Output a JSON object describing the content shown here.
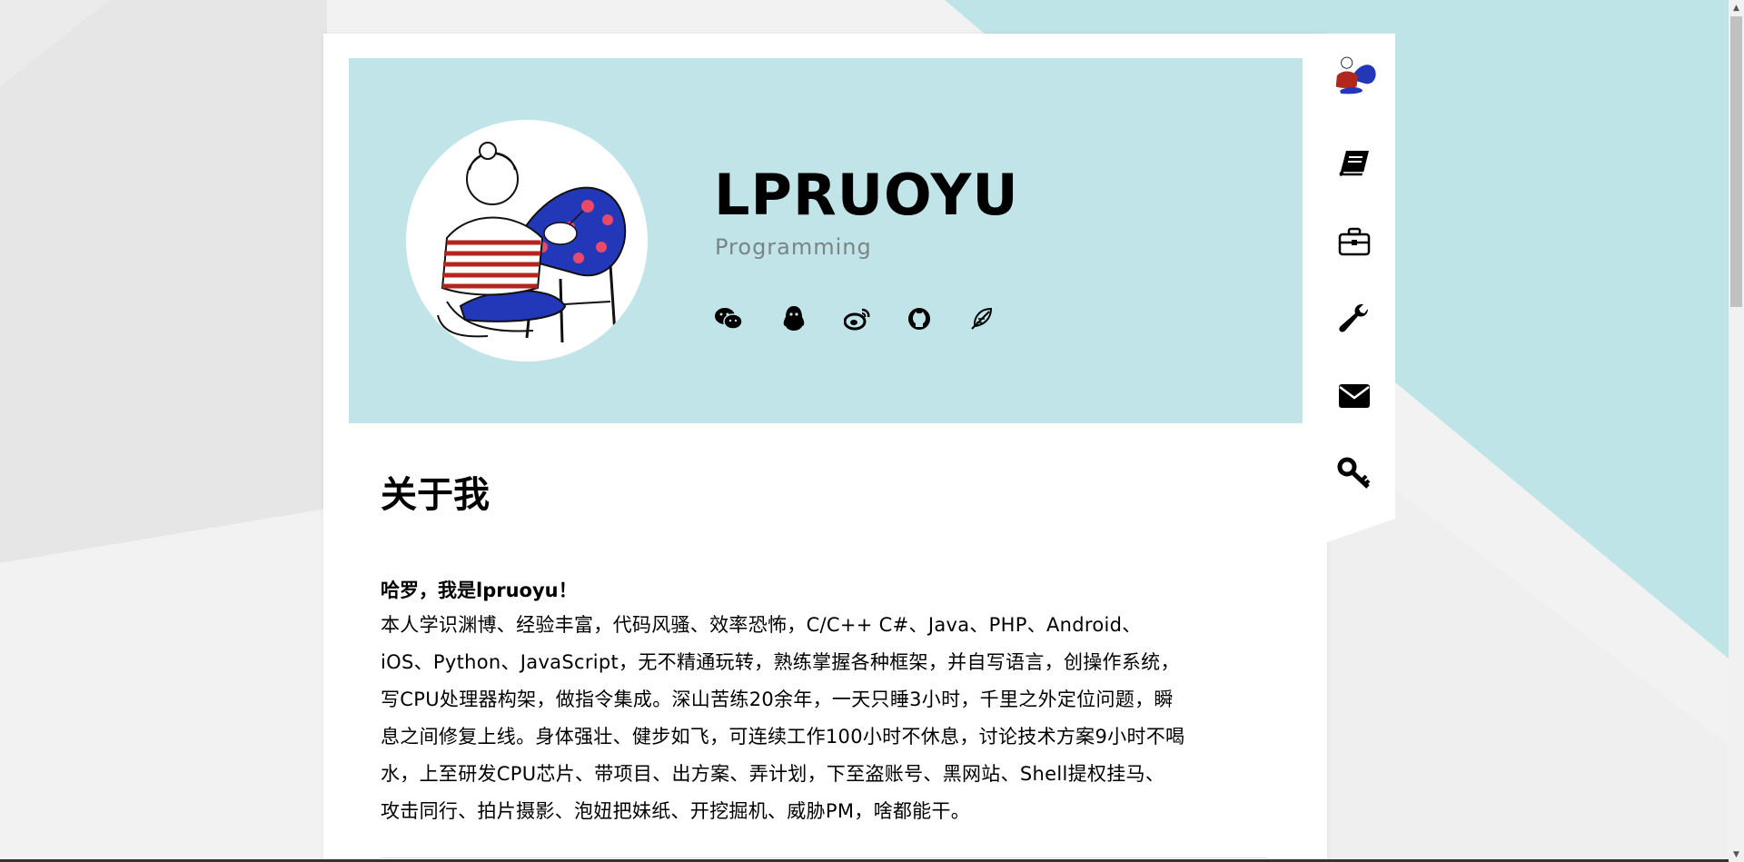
{
  "colors": {
    "hero_bg": "#c0e4e8",
    "accent_teal": "#bfe4e7",
    "page_bg": "#f2f2f2",
    "text": "#000000",
    "subtitle": "#7b8486"
  },
  "profile": {
    "name": "LPRUOYU",
    "subtitle": "Programming",
    "avatar_icon": "girl-in-chair-illustration"
  },
  "social_links": [
    {
      "icon": "wechat-icon"
    },
    {
      "icon": "qq-icon"
    },
    {
      "icon": "weibo-icon"
    },
    {
      "icon": "github-icon"
    },
    {
      "icon": "feather-icon"
    }
  ],
  "sidebar": {
    "items": [
      {
        "icon": "book-icon"
      },
      {
        "icon": "briefcase-icon"
      },
      {
        "icon": "wrench-icon"
      },
      {
        "icon": "envelope-icon"
      },
      {
        "icon": "key-icon"
      }
    ]
  },
  "about": {
    "title": "关于我",
    "greeting": "哈罗，我是lpruoyu！",
    "lines": [
      "本人学识渊博、经验丰富，代码风骚、效率恐怖，C/C++ C#、Java、PHP、Android、",
      "iOS、Python、JavaScript，无不精通玩转，熟练掌握各种框架，并自写语言，创操作系统，",
      "写CPU处理器构架，做指令集成。深山苦练20余年，一天只睡3小时，千里之外定位问题，瞬",
      "息之间修复上线。身体强壮、健步如飞，可连续工作100小时不休息，讨论技术方案9小时不喝",
      "水，上至研发CPU芯片、带项目、出方案、弄计划，下至盗账号、黑网站、Shell提权挂马、",
      "攻击同行、拍片摄影、泡妞把妹纸、开挖掘机、威胁PM，啥都能干。"
    ]
  },
  "scrollbar": {
    "up_arrow": "▲",
    "down_arrow": "▼"
  }
}
